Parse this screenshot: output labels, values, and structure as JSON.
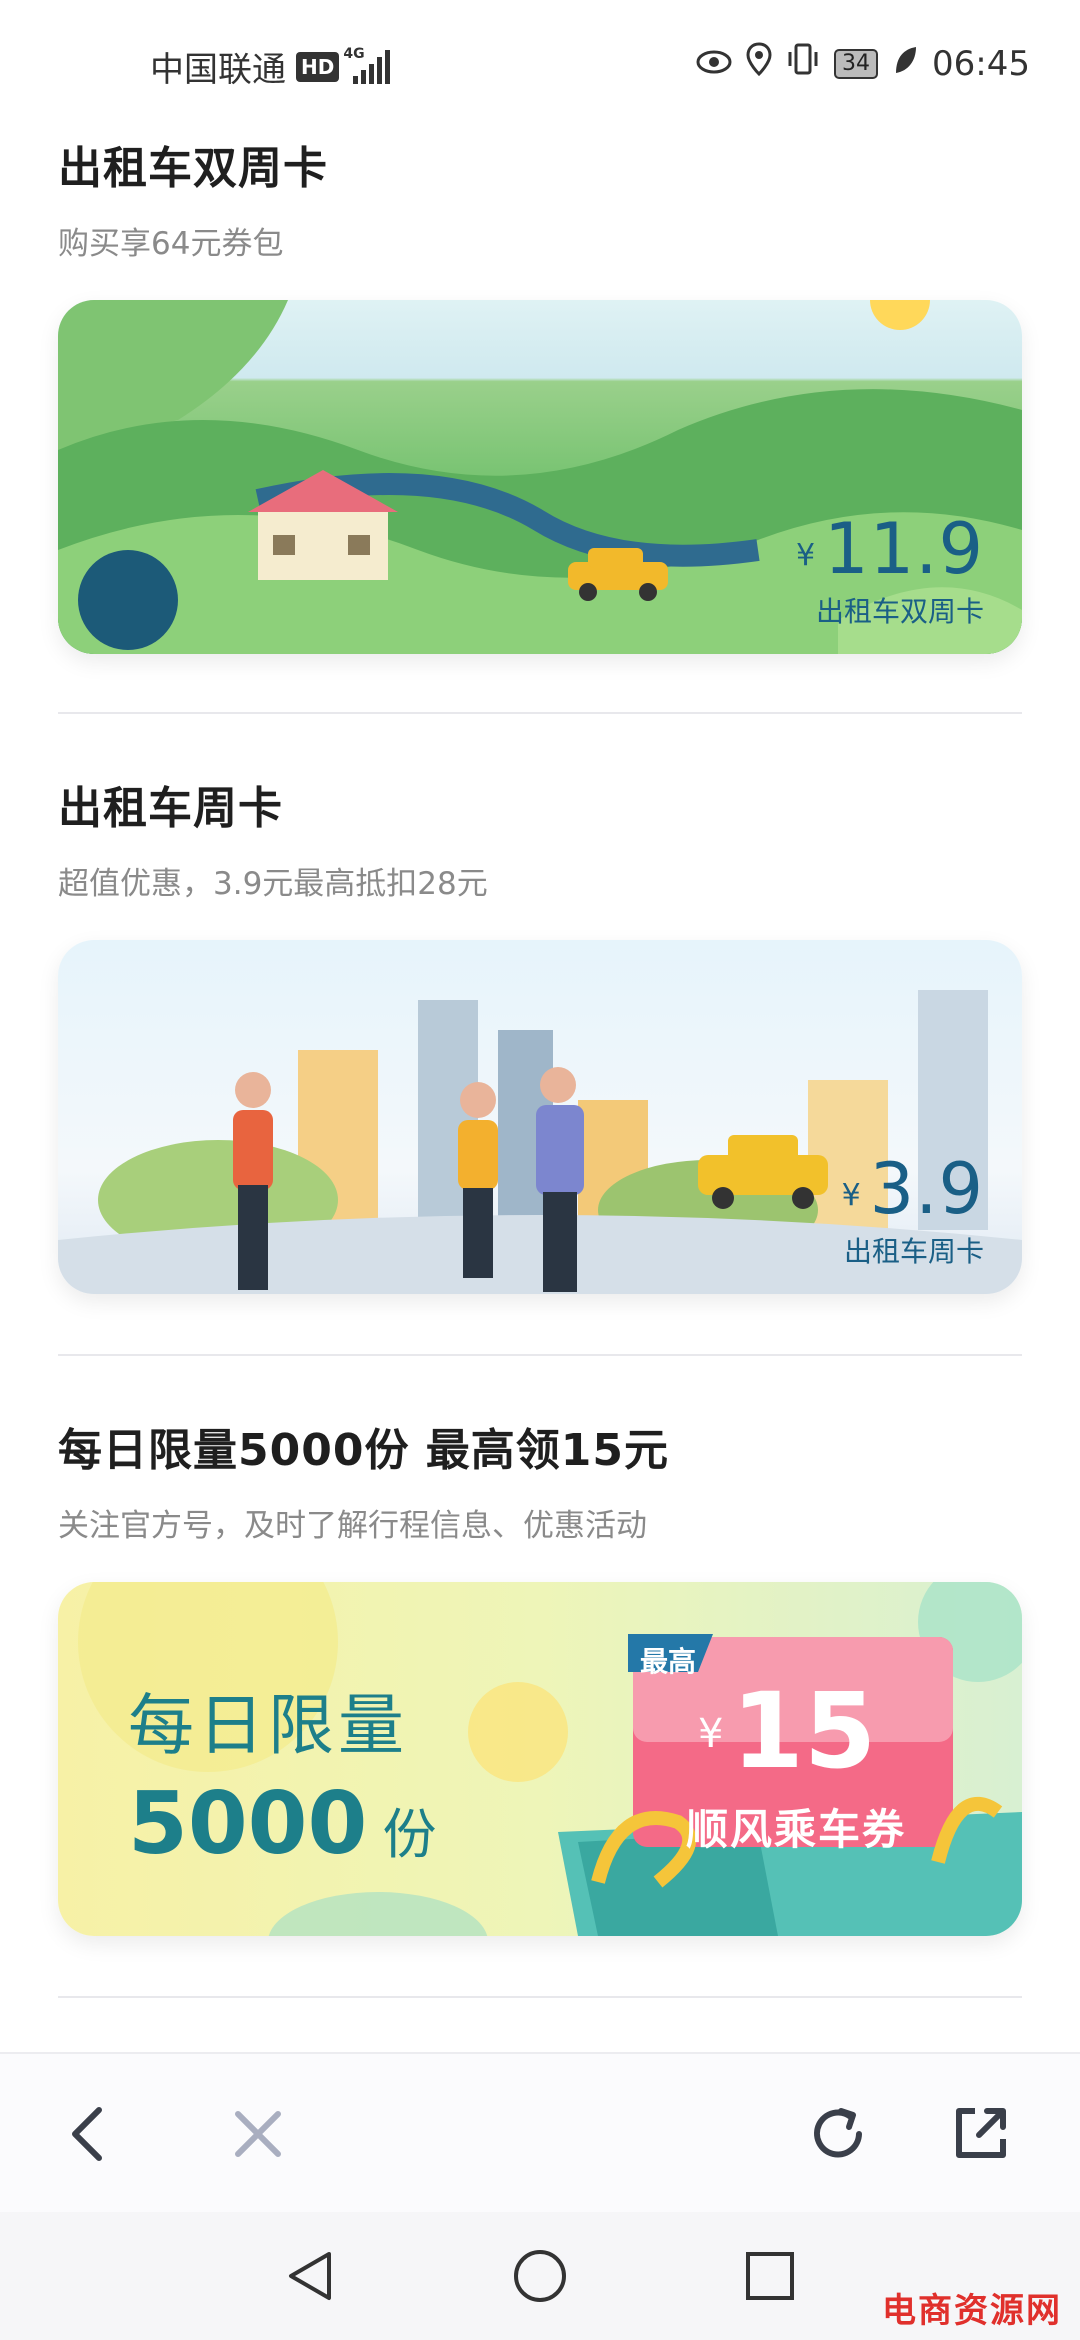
{
  "status_bar": {
    "carrier": "中国联通",
    "hd": "HD",
    "network": "4G",
    "battery": "34",
    "time": "06:45"
  },
  "sections": [
    {
      "title": "出租车双周卡",
      "subtitle": "购买享64元券包",
      "banner": {
        "currency": "¥",
        "price": "11.9",
        "label": "出租车双周卡"
      }
    },
    {
      "title": "出租车周卡",
      "subtitle": "超值优惠，3.9元最高抵扣28元",
      "banner": {
        "currency": "¥",
        "price": "3.9",
        "label": "出租车周卡"
      }
    },
    {
      "title": "每日限量5000份 最高领15元",
      "subtitle": "关注官方号，及时了解行程信息、优惠活动",
      "banner": {
        "line1": "每日限量",
        "number": "5000",
        "unit": "份",
        "tag": "最高",
        "currency": "¥",
        "amount": "15",
        "coupon_label": "顺风乘车券"
      }
    }
  ],
  "nav": {
    "back_icon": "chevron-left-icon",
    "close_icon": "close-icon",
    "refresh_icon": "refresh-icon",
    "share_icon": "share-external-icon"
  },
  "watermark": "电商资源网",
  "colors": {
    "accent": "#1a5f86",
    "teal": "#1d7f8a",
    "coupon": "#f0607a"
  }
}
